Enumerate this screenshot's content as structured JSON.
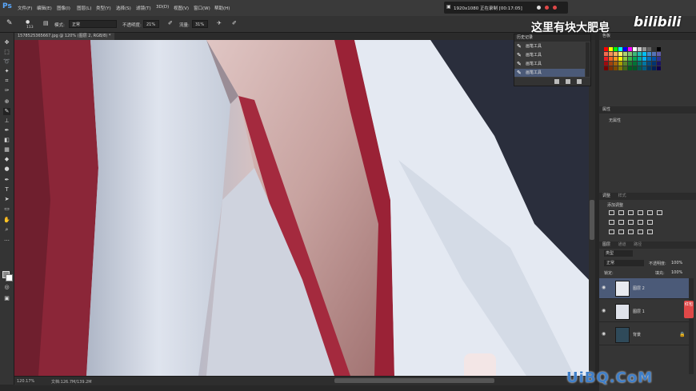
{
  "menubar": {
    "logo": "Ps",
    "items": [
      "文件(F)",
      "编辑(E)",
      "图像(I)",
      "图层(L)",
      "类型(Y)",
      "选择(S)",
      "滤镜(T)",
      "3D(D)",
      "视图(V)",
      "窗口(W)",
      "帮助(H)"
    ],
    "recording_info": "1920x1080  正在录制 [00:17:05]"
  },
  "options": {
    "brush_size": "113",
    "mode_label": "模式:",
    "mode_value": "正常",
    "opacity_label": "不透明度:",
    "opacity_value": "21%",
    "flow_label": "流量:",
    "flow_value": "31%"
  },
  "watermark": {
    "caption": "这里有块大肥皂",
    "bili": "bilibili",
    "site": "UiBQ.CoM"
  },
  "document": {
    "tab_title": "1578525365667.jpg @ 120% (图层 2, RGB/8) *",
    "zoom": "120.17%",
    "doc_info": "文档:126.7M/139.2M"
  },
  "history": {
    "title": "历史记录",
    "rows": [
      "画笔工具",
      "画笔工具",
      "画笔工具",
      "画笔工具"
    ]
  },
  "panels": {
    "swatches_tab": "色板",
    "properties_tab": "属性",
    "properties_value": "无属性",
    "adjustments_tab": "调整",
    "styles_tab": "样式",
    "adjust_label": "添加调整",
    "layers_tab": "图层",
    "channels_tab": "通道",
    "paths_tab": "路径",
    "blend_mode": "正常",
    "layer_opacity_label": "不透明度:",
    "layer_opacity": "100%",
    "lock_label": "锁定:",
    "fill_label": "填充:",
    "fill_value": "100%",
    "kind_label": "类型"
  },
  "layers": [
    {
      "name": "图层 2",
      "selected": true
    },
    {
      "name": "图层 1",
      "selected": false
    },
    {
      "name": "背景",
      "selected": false
    }
  ],
  "vip_badge": "红包",
  "colors": {
    "selection_blue": "#4b5a78",
    "accent": "#5aa9ff"
  }
}
